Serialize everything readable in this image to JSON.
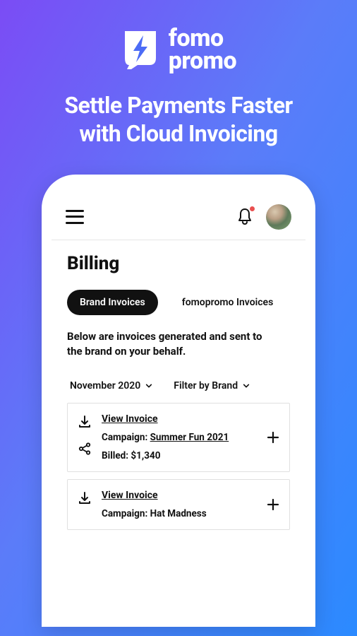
{
  "brand": {
    "logo_line1": "fomo",
    "logo_line2": "promo"
  },
  "headline_line1": "Settle Payments Faster",
  "headline_line2": "with Cloud Invoicing",
  "icons": {
    "menu": "menu-icon",
    "bell": "bell-icon",
    "chevron_down": "chevron-down-icon",
    "download": "download-icon",
    "share": "share-icon",
    "plus": "plus-icon"
  },
  "screen": {
    "page_title": "Billing",
    "tabs": [
      {
        "label": "Brand Invoices",
        "active": true
      },
      {
        "label": "fomopromo Invoices",
        "active": false
      }
    ],
    "description": "Below are invoices generated and sent to the brand on your behalf.",
    "filters": {
      "date": "November 2020",
      "brand": "Filter by Brand"
    },
    "invoices": [
      {
        "view_label": "View Invoice",
        "campaign_label": "Campaign",
        "campaign_value": "Summer Fun 2021",
        "billed_label": "Billed",
        "billed_value": "$1,340"
      },
      {
        "view_label": "View Invoice",
        "campaign_label": "Campaign",
        "campaign_value": "Hat Madness"
      }
    ]
  }
}
